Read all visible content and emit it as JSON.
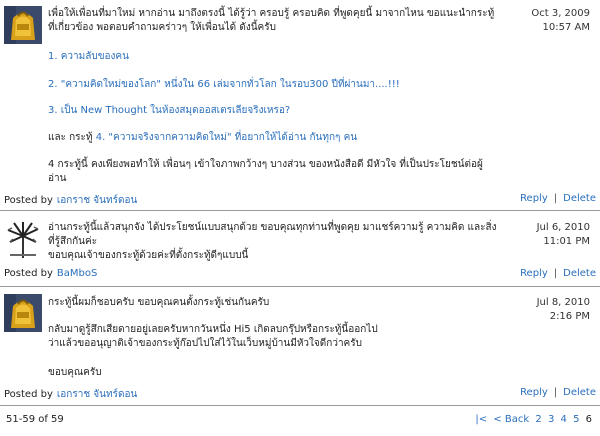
{
  "comments": [
    {
      "date_line1": "Oct 3, 2009",
      "date_line2": "10:57 AM",
      "intro": "เพื่อให้เพื่อนที่มาใหม่ หากอ่าน มาถึงตรงนี้ ได้รู้ว่า ครอบรู้ ครอบคิด ที่พูดคุยนี้ มาจากไหน ขอแนะนำกระทู้ ที่เกี่ยวข้อง พอตอบคำถามคร่าวๆ ให้เพื่อนได้ ดังนี้ครับ",
      "links": [
        "1. ความลับของคน",
        "2. \"ความคิดใหม่ของโลก\" หนึ่งใน 66 เล่มจากทั่วโลก ในรอบ300 ปีที่ผ่านมา....!!!",
        "3. เป็น New Thought ในห้องสมุดออสเตรเลียจริงเหรอ?"
      ],
      "line4_prefix": "และ กระทู้ ",
      "line4_link": "4. \"ความจริงจากความคิดใหม่\" ที่อยากให้ได้อ่าน กันทุกๆ คน",
      "closing": "4 กระทู้นี้ คงเพียงพอทำให้ เพื่อนๆ เข้าใจภาพกว้างๆ บางส่วน ของหนังสือดี มีหัวใจ ที่เป็นประโยชน์ต่อผู้อ่าน",
      "posted_label": "Posted by",
      "author": "เอกราช จันทร์ดอน",
      "reply": "Reply",
      "delete": "Delete"
    },
    {
      "date_line1": "Jul 6, 2010",
      "date_line2": "11:01 PM",
      "para1": "อ่านกระทู้นี้แล้วสนุกจัง ได้ประโยชน์แบบสนุกด้วย ขอบคุณทุกท่านที่พูดคุย มาแชร์ความรู้ ความคิด และสิ่งที่รู้สึกกันค่ะ",
      "para2": "ขอบคุณเจ้าของกระทู้ด้วยค่ะที่ตั้งกระทู้ดีๆแบบนี้",
      "posted_label": "Posted by",
      "author": "BaMboS",
      "reply": "Reply",
      "delete": "Delete"
    },
    {
      "date_line1": "Jul 8, 2010",
      "date_line2": "2:16 PM",
      "para1": "กระทู้นี้ผมก็ชอบครับ ขอบคุณคนตั้งกระทู้เช่นกันครับ",
      "para2a": "กลับมาดูรู้สึกเสียดายอยู่เลยครับหากวันหนึ่ง Hi5 เกิดลบกรุ๊ปหรือกระทู้นี้ออกไป",
      "para2b": "ว่าแล้วขออนุญาติเจ้าของกระทู้ก๊อปไปใส่ไว้ในเว็บหมู่บ้านมีหัวใจดีกว่าครับ",
      "para3": "ขอบคุณครับ",
      "posted_label": "Posted by",
      "author": "เอกราช จันทร์ดอน",
      "reply": "Reply",
      "delete": "Delete"
    }
  ],
  "pager": {
    "count": "51-59 of 59",
    "first": "|<",
    "back": "< Back",
    "pages": [
      "2",
      "3",
      "4",
      "5"
    ],
    "current": "6"
  }
}
